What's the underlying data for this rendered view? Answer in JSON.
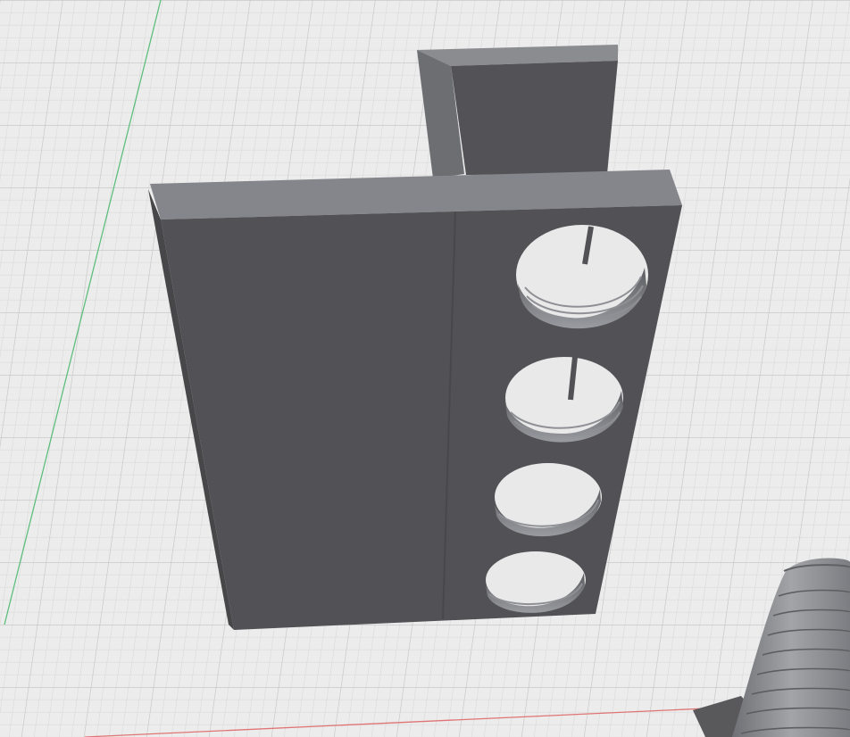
{
  "viewport": {
    "background": "#ececec",
    "grid_minor_color": "#d6d6d6",
    "grid_major_color": "#c4c4c4",
    "y_axis_color": "#5bbf7a",
    "x_axis_color": "#e07474"
  },
  "model": {
    "part_color": "#525256",
    "part_top_color": "#85868b",
    "hole_count": 4,
    "thread_color": "#7f8085"
  },
  "bolt": {
    "color": "#8a8a8f"
  }
}
